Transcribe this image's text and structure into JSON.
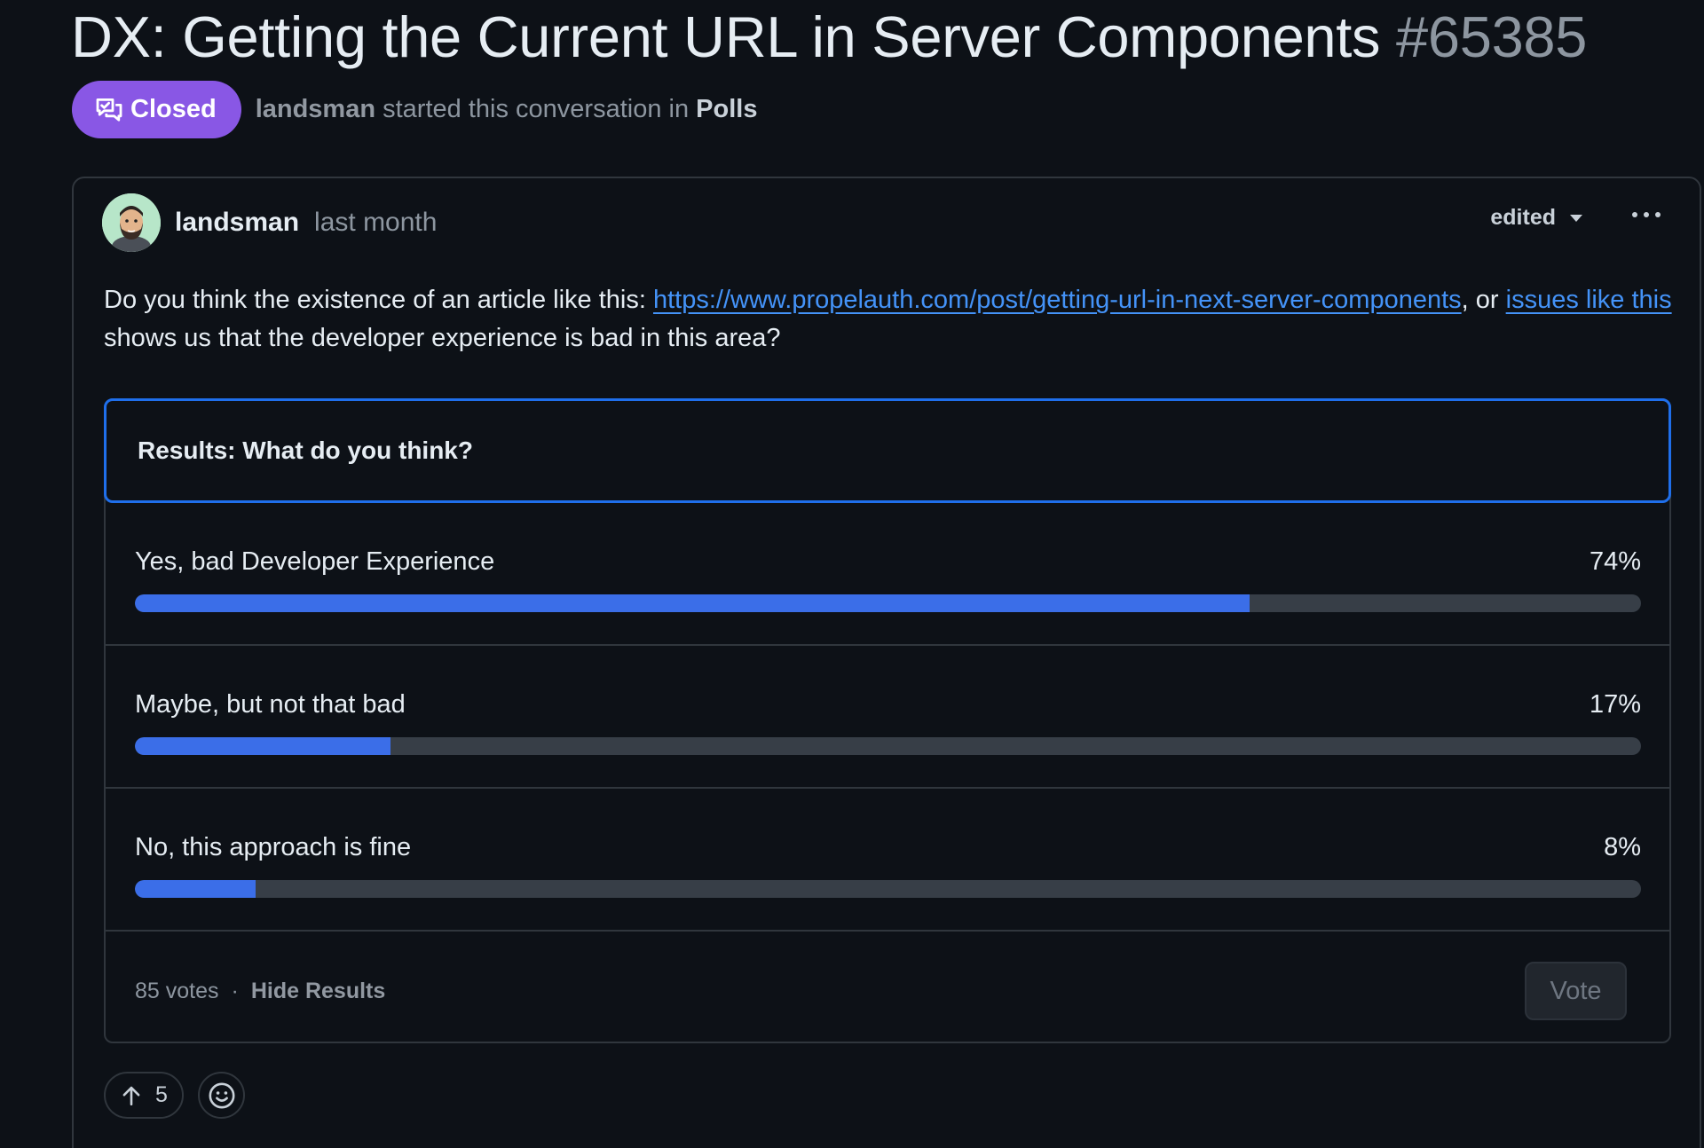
{
  "discussion": {
    "title": "DX: Getting the Current URL in Server Components",
    "number": "#65385",
    "state": "Closed",
    "author": "landsman",
    "started_text": "started this conversation in",
    "category": "Polls"
  },
  "post": {
    "author": "landsman",
    "time": "last month",
    "edited_label": "edited",
    "body_prefix": "Do you think the existence of an article like this: ",
    "link_url_text": "https://www.propelauth.com/post/getting-url-in-next-server-components",
    "body_mid": ", or ",
    "link2_text": "issues like this",
    "body_suffix": " shows us that the developer experience is bad in this area?"
  },
  "poll": {
    "title": "Results: What do you think?",
    "options": [
      {
        "label": "Yes, bad Developer Experience",
        "percent_text": "74%",
        "percent": 74
      },
      {
        "label": "Maybe, but not that bad",
        "percent_text": "17%",
        "percent": 17
      },
      {
        "label": "No, this approach is fine",
        "percent_text": "8%",
        "percent": 8
      }
    ],
    "votes_text": "85 votes",
    "separator": "·",
    "hide_results_label": "Hide Results",
    "vote_label": "Vote"
  },
  "reactions": {
    "upvote_count": "5"
  },
  "colors": {
    "background": "#0d1117",
    "closed_badge": "#8957e5",
    "accent_blue": "#1f6feb",
    "bar_fill": "#3b6ee8",
    "bar_track": "#373e47",
    "link": "#4493f8"
  },
  "icons": {
    "state": "discussion-closed-icon",
    "upvote": "arrow-up-icon",
    "reaction": "smiley-icon",
    "menu": "kebab-horizontal-icon",
    "edited": "triangle-down-icon"
  }
}
